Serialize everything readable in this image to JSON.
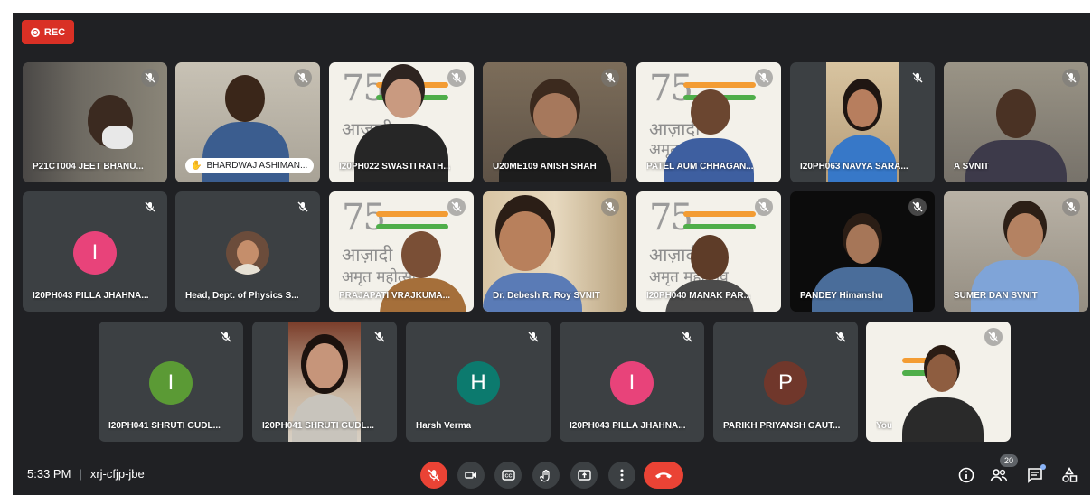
{
  "recording": {
    "label": "REC"
  },
  "participants": [
    {
      "name": "P21CT004 JEET BHANU..."
    },
    {
      "name": "BHARDWAJ ASHIMAN..."
    },
    {
      "name": "I20PH022 SWASTI RATH..."
    },
    {
      "name": "U20ME109 ANISH SHAH"
    },
    {
      "name": "PATEL AUM CHHAGAN..."
    },
    {
      "name": "I20PH063 NAVYA SARA..."
    },
    {
      "name": "A SVNIT"
    },
    {
      "name": "I20PH043 PILLA JHAHNA...",
      "initial": "I",
      "color": "#e8437a"
    },
    {
      "name": "Head, Dept. of Physics S..."
    },
    {
      "name": "PRAJAPATI VRAJKUMA..."
    },
    {
      "name": "Dr. Debesh R. Roy SVNIT"
    },
    {
      "name": "I20PH040 MANAK PAR..."
    },
    {
      "name": "PANDEY Himanshu"
    },
    {
      "name": "SUMER DAN SVNIT"
    },
    {
      "name": "I20PH041 SHRUTI GUDL...",
      "initial": "I",
      "color": "#5b9a35"
    },
    {
      "name": "I20PH041 SHRUTI GUDL..."
    },
    {
      "name": "Harsh Verma",
      "initial": "H",
      "color": "#0c7a6e"
    },
    {
      "name": "I20PH043 PILLA JHAHNA...",
      "initial": "I",
      "color": "#e8437a"
    },
    {
      "name": "PARIKH PRIYANSH GAUT...",
      "initial": "P",
      "color": "#70372b"
    },
    {
      "name": "You"
    }
  ],
  "banner_text": {
    "line1": "आज़ादी",
    "line2": "अमृत महोत्सव",
    "numeral": "75"
  },
  "meeting": {
    "time": "5:33 PM",
    "separator": "|",
    "code": "xrj-cfjp-jbe"
  },
  "people_count": "20",
  "icons": {
    "mic": "mic-off-icon",
    "camera": "videocam-icon",
    "captions": "closed-caption-icon",
    "hand": "raise-hand-icon",
    "present": "present-screen-icon",
    "more": "more-vert-icon",
    "hangup": "call-end-icon",
    "info": "info-icon",
    "people": "people-icon",
    "chat": "chat-icon",
    "activities": "activities-icon"
  },
  "colors": {
    "background": "#202124",
    "tile": "#3c4043",
    "danger": "#ea4335",
    "rec": "#d93025"
  }
}
